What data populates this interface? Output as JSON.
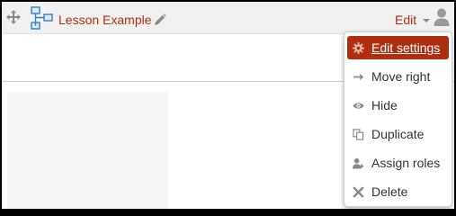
{
  "header": {
    "move_icon": "move-arrows-icon",
    "activity_icon": "lesson-icon",
    "activity_title": "Lesson Example",
    "edit_title_icon": "pencil-icon",
    "edit_label": "Edit",
    "user_icon": "user-icon"
  },
  "menu": {
    "items": [
      {
        "label": "Edit settings",
        "icon": "gear-icon",
        "active": true
      },
      {
        "label": "Move right",
        "icon": "arrow-right-icon"
      },
      {
        "label": "Hide",
        "icon": "eye-icon"
      },
      {
        "label": "Duplicate",
        "icon": "duplicate-icon"
      },
      {
        "label": "Assign roles",
        "icon": "assign-roles-icon"
      },
      {
        "label": "Delete",
        "icon": "delete-x-icon"
      }
    ]
  },
  "colors": {
    "accent": "#b02e10",
    "header_bg": "#f1f1f1",
    "icon_gray": "#8a8a8a"
  }
}
